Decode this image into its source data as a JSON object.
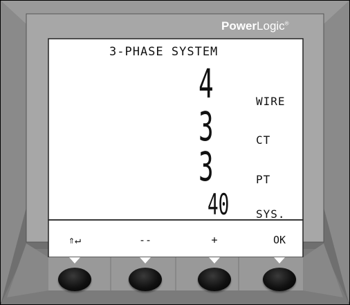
{
  "brand": {
    "name_bold": "Power",
    "name_light": "Logic",
    "trademark": "®"
  },
  "screen": {
    "title": "3-PHASE SYSTEM",
    "rows": [
      {
        "value": "4",
        "label": "WIRE"
      },
      {
        "value": "3",
        "label": "CT"
      },
      {
        "value": "3",
        "label": "PT"
      },
      {
        "value": "40",
        "label": "SYS."
      }
    ]
  },
  "softkeys": [
    {
      "label": "⇑↵",
      "name": "up-enter"
    },
    {
      "label": "--",
      "name": "minus"
    },
    {
      "label": "+",
      "name": "plus"
    },
    {
      "label": "OK",
      "name": "ok"
    }
  ],
  "colors": {
    "bezel_outer": "#7d7d7d",
    "bezel_inner": "#a9a9a9",
    "lcd": "#ffffff",
    "key": "#111111"
  }
}
